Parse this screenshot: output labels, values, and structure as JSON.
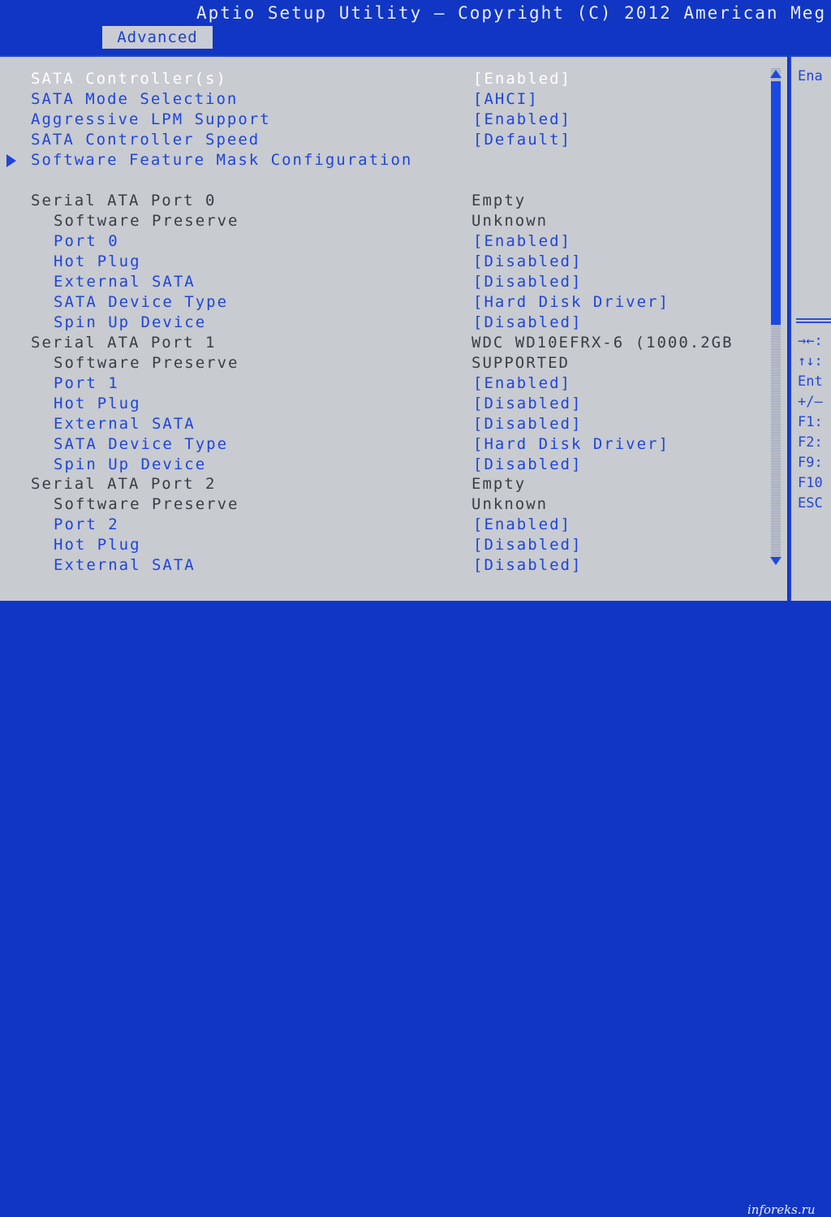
{
  "header": {
    "title": "Aptio Setup Utility – Copyright (C) 2012 American Meg",
    "active_tab": "Advanced"
  },
  "rows": [
    {
      "label": "SATA Controller(s)",
      "value": "[Enabled]",
      "indent": 0,
      "style": "white",
      "submenu": false
    },
    {
      "label": "SATA Mode Selection",
      "value": "[AHCI]",
      "indent": 0,
      "style": "blue",
      "submenu": false
    },
    {
      "label": "Aggressive LPM Support",
      "value": "[Enabled]",
      "indent": 0,
      "style": "blue",
      "submenu": false
    },
    {
      "label": "SATA Controller Speed",
      "value": "[Default]",
      "indent": 0,
      "style": "blue",
      "submenu": false
    },
    {
      "label": "Software Feature Mask Configuration",
      "value": "",
      "indent": 0,
      "style": "blue",
      "submenu": true
    },
    {
      "label": "Serial ATA Port 0",
      "value": "Empty",
      "indent": 0,
      "style": "gray",
      "submenu": false
    },
    {
      "label": "Software Preserve",
      "value": "Unknown",
      "indent": 1,
      "style": "gray",
      "submenu": false
    },
    {
      "label": "Port 0",
      "value": "[Enabled]",
      "indent": 1,
      "style": "blue",
      "submenu": false
    },
    {
      "label": "Hot Plug",
      "value": "[Disabled]",
      "indent": 1,
      "style": "blue",
      "submenu": false
    },
    {
      "label": "External SATA",
      "value": "[Disabled]",
      "indent": 1,
      "style": "blue",
      "submenu": false
    },
    {
      "label": "SATA Device Type",
      "value": "[Hard Disk Driver]",
      "indent": 1,
      "style": "blue",
      "submenu": false
    },
    {
      "label": "Spin Up Device",
      "value": "[Disabled]",
      "indent": 1,
      "style": "blue",
      "submenu": false
    },
    {
      "label": "Serial ATA Port 1",
      "value": "WDC WD10EFRX-6 (1000.2GB",
      "indent": 0,
      "style": "gray",
      "submenu": false
    },
    {
      "label": "Software Preserve",
      "value": "SUPPORTED",
      "indent": 1,
      "style": "gray",
      "submenu": false
    },
    {
      "label": "Port 1",
      "value": "[Enabled]",
      "indent": 1,
      "style": "blue",
      "submenu": false
    },
    {
      "label": "Hot Plug",
      "value": "[Disabled]",
      "indent": 1,
      "style": "blue",
      "submenu": false
    },
    {
      "label": "External SATA",
      "value": "[Disabled]",
      "indent": 1,
      "style": "blue",
      "submenu": false
    },
    {
      "label": "SATA Device Type",
      "value": "[Hard Disk Driver]",
      "indent": 1,
      "style": "blue",
      "submenu": false
    },
    {
      "label": "Spin Up Device",
      "value": "[Disabled]",
      "indent": 1,
      "style": "blue",
      "submenu": false
    },
    {
      "label": "Serial ATA Port 2",
      "value": "Empty",
      "indent": 0,
      "style": "gray",
      "submenu": false
    },
    {
      "label": "Software Preserve",
      "value": "Unknown",
      "indent": 1,
      "style": "gray",
      "submenu": false
    },
    {
      "label": "Port 2",
      "value": "[Enabled]",
      "indent": 1,
      "style": "blue",
      "submenu": false
    },
    {
      "label": "Hot Plug",
      "value": "[Disabled]",
      "indent": 1,
      "style": "blue",
      "submenu": false
    },
    {
      "label": "External SATA",
      "value": "[Disabled]",
      "indent": 1,
      "style": "blue",
      "submenu": false
    }
  ],
  "help_panel": {
    "description": "Ena",
    "keys": [
      "→←:",
      "↑↓:",
      "Ent",
      "+/–",
      "F1:",
      "F2:",
      "F9:",
      "F10",
      "ESC"
    ]
  },
  "watermark": "inforeks.ru",
  "colors": {
    "frame_blue": "#1136c4",
    "panel_gray": "#c8cbd0",
    "item_blue": "#1f45da",
    "selected_white": "#ffffff",
    "static_gray": "#3a3d44"
  }
}
